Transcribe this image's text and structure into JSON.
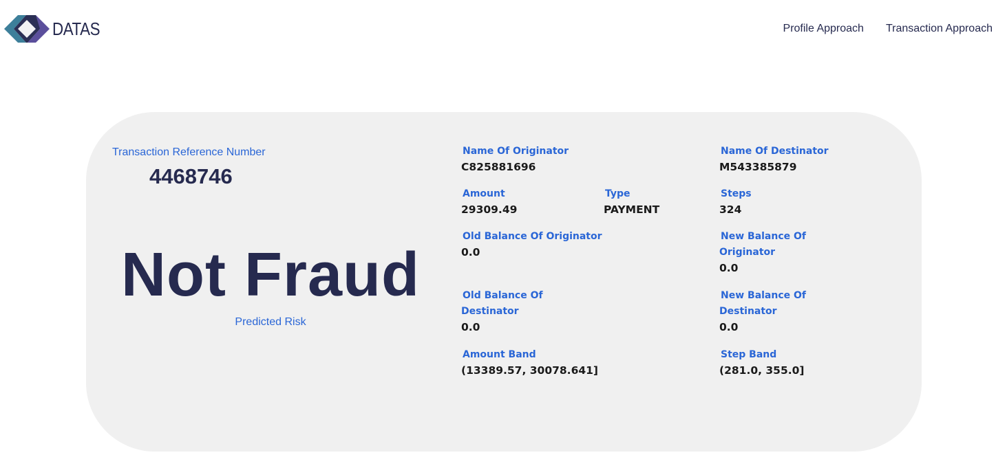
{
  "header": {
    "logo_text": "DATAS",
    "nav": [
      "Profile Approach",
      "Transaction Approach"
    ]
  },
  "result": {
    "ref_label": "Transaction Reference Number",
    "ref_value": "4468746",
    "verdict": "Not Fraud",
    "verdict_label": "Predicted Risk"
  },
  "fields": {
    "name_orig": {
      "label": "Name Of Originator",
      "value": "C825881696"
    },
    "name_dest": {
      "label": "Name Of Destinator",
      "value": "M543385879"
    },
    "amount": {
      "label": "Amount",
      "value": "29309.49"
    },
    "type": {
      "label": "Type",
      "value": "PAYMENT"
    },
    "steps": {
      "label": "Steps",
      "value": "324"
    },
    "old_bal_orig": {
      "label": "Old Balance Of Originator",
      "value": "0.0"
    },
    "new_bal_orig": {
      "label_1": "New Balance Of",
      "label_2": "Originator",
      "value": "0.0"
    },
    "old_bal_dest": {
      "label_1": "Old Balance Of",
      "label_2": "Destinator",
      "value": "0.0"
    },
    "new_bal_dest": {
      "label_1": "New Balance Of",
      "label_2": "Destinator",
      "value": "0.0"
    },
    "amount_band": {
      "label": "Amount Band",
      "value": "(13389.57, 30078.641]"
    },
    "step_band": {
      "label": "Step Band",
      "value": "(281.0, 355.0]"
    }
  },
  "colors": {
    "brand_dark": "#262a4f",
    "label_blue": "#2a66d6",
    "card_bg": "#f0f0f0"
  }
}
